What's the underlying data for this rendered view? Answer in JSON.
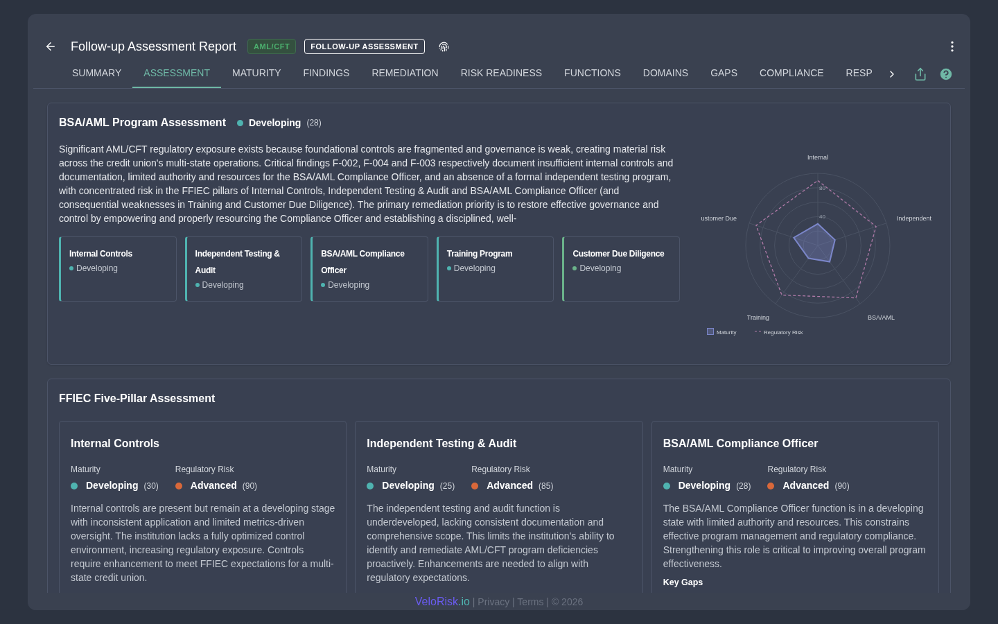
{
  "header": {
    "title": "Follow-up Assessment Report",
    "tag": "AML/CFT",
    "badge": "FOLLOW-UP ASSESSMENT"
  },
  "tabs": [
    {
      "label": "SUMMARY",
      "selected": false
    },
    {
      "label": "ASSESSMENT",
      "selected": true
    },
    {
      "label": "MATURITY",
      "selected": false
    },
    {
      "label": "FINDINGS",
      "selected": false
    },
    {
      "label": "REMEDIATION",
      "selected": false
    },
    {
      "label": "RISK READINESS",
      "selected": false
    },
    {
      "label": "FUNCTIONS",
      "selected": false
    },
    {
      "label": "DOMAINS",
      "selected": false
    },
    {
      "label": "GAPS",
      "selected": false
    },
    {
      "label": "COMPLIANCE",
      "selected": false
    },
    {
      "label": "RESP",
      "selected": false
    }
  ],
  "program": {
    "title": "BSA/AML Program Assessment",
    "status": "Developing",
    "score": "(28)",
    "summary": "Significant AML/CFT regulatory exposure exists because foundational controls are fragmented and governance is weak, creating material risk across the credit union's multi-state operations. Critical findings F-002, F-004 and F-003 respectively document insufficient internal controls and documentation, limited authority and resources for the BSA/AML Compliance Officer, and an absence of a formal independent testing program, with concentrated risk in the FFIEC pillars of Internal Controls, Independent Testing & Audit and BSA/AML Compliance Officer (and consequential weaknesses in Training and Customer Due Diligence). The primary remediation priority is to restore effective governance and control by empowering and properly resourcing the Compliance Officer and establishing a disciplined, well-",
    "pillars": [
      {
        "name": "Internal Controls",
        "status": "Developing",
        "color": "#4fb3b0"
      },
      {
        "name": "Independent Testing & Audit",
        "status": "Developing",
        "color": "#4fb3b0"
      },
      {
        "name": "BSA/AML Compliance Officer",
        "status": "Developing",
        "color": "#4fb3b0"
      },
      {
        "name": "Training Program",
        "status": "Developing",
        "color": "#4fb3b0"
      },
      {
        "name": "Customer Due Diligence",
        "status": "Developing",
        "color": "#6bb38a"
      }
    ],
    "chart_data": {
      "type": "radar",
      "legend": "bottom-left",
      "categories": [
        "Internal",
        "Independent",
        "BSA/AML",
        "Training",
        "ustomer Due"
      ],
      "ylim": [
        0,
        100
      ],
      "yticks": [
        40,
        80
      ],
      "series": [
        {
          "name": "Maturity",
          "color": "#7b86c9",
          "values": [
            30,
            25,
            28,
            22,
            35
          ]
        },
        {
          "name": "Regulatory Risk",
          "color": "#b07aa8",
          "values": [
            90,
            85,
            90,
            85,
            90
          ]
        }
      ]
    }
  },
  "ffiec": {
    "title": "FFIEC Five-Pillar Assessment",
    "cards": [
      {
        "title": "Internal Controls",
        "maturity_label": "Maturity",
        "maturity": "Developing",
        "maturity_score": "(30)",
        "risk_label": "Regulatory Risk",
        "risk": "Advanced",
        "risk_score": "(90)",
        "text": "Internal controls are present but remain at a developing stage with inconsistent application and limited metrics-driven oversight. The institution lacks a fully optimized control environment, increasing regulatory exposure. Controls require enhancement to meet FFIEC expectations for a multi-state credit union."
      },
      {
        "title": "Independent Testing & Audit",
        "maturity_label": "Maturity",
        "maturity": "Developing",
        "maturity_score": "(25)",
        "risk_label": "Regulatory Risk",
        "risk": "Advanced",
        "risk_score": "(85)",
        "text": "The independent testing and audit function is underdeveloped, lacking consistent documentation and comprehensive scope. This limits the institution's ability to identify and remediate AML/CFT program deficiencies proactively. Enhancements are needed to align with regulatory expectations."
      },
      {
        "title": "BSA/AML Compliance Officer",
        "maturity_label": "Maturity",
        "maturity": "Developing",
        "maturity_score": "(28)",
        "risk_label": "Regulatory Risk",
        "risk": "Advanced",
        "risk_score": "(90)",
        "text": "The BSA/AML Compliance Officer function is in a developing state with limited authority and resources. This constrains effective program management and regulatory compliance. Strengthening this role is critical to improving overall program effectiveness.",
        "gaps_label": "Key Gaps"
      }
    ]
  },
  "footer": {
    "brand": "VeloRisk",
    "brand_suffix": ".io",
    "links": [
      " | Privacy",
      " | Terms",
      " | © 2026"
    ]
  }
}
